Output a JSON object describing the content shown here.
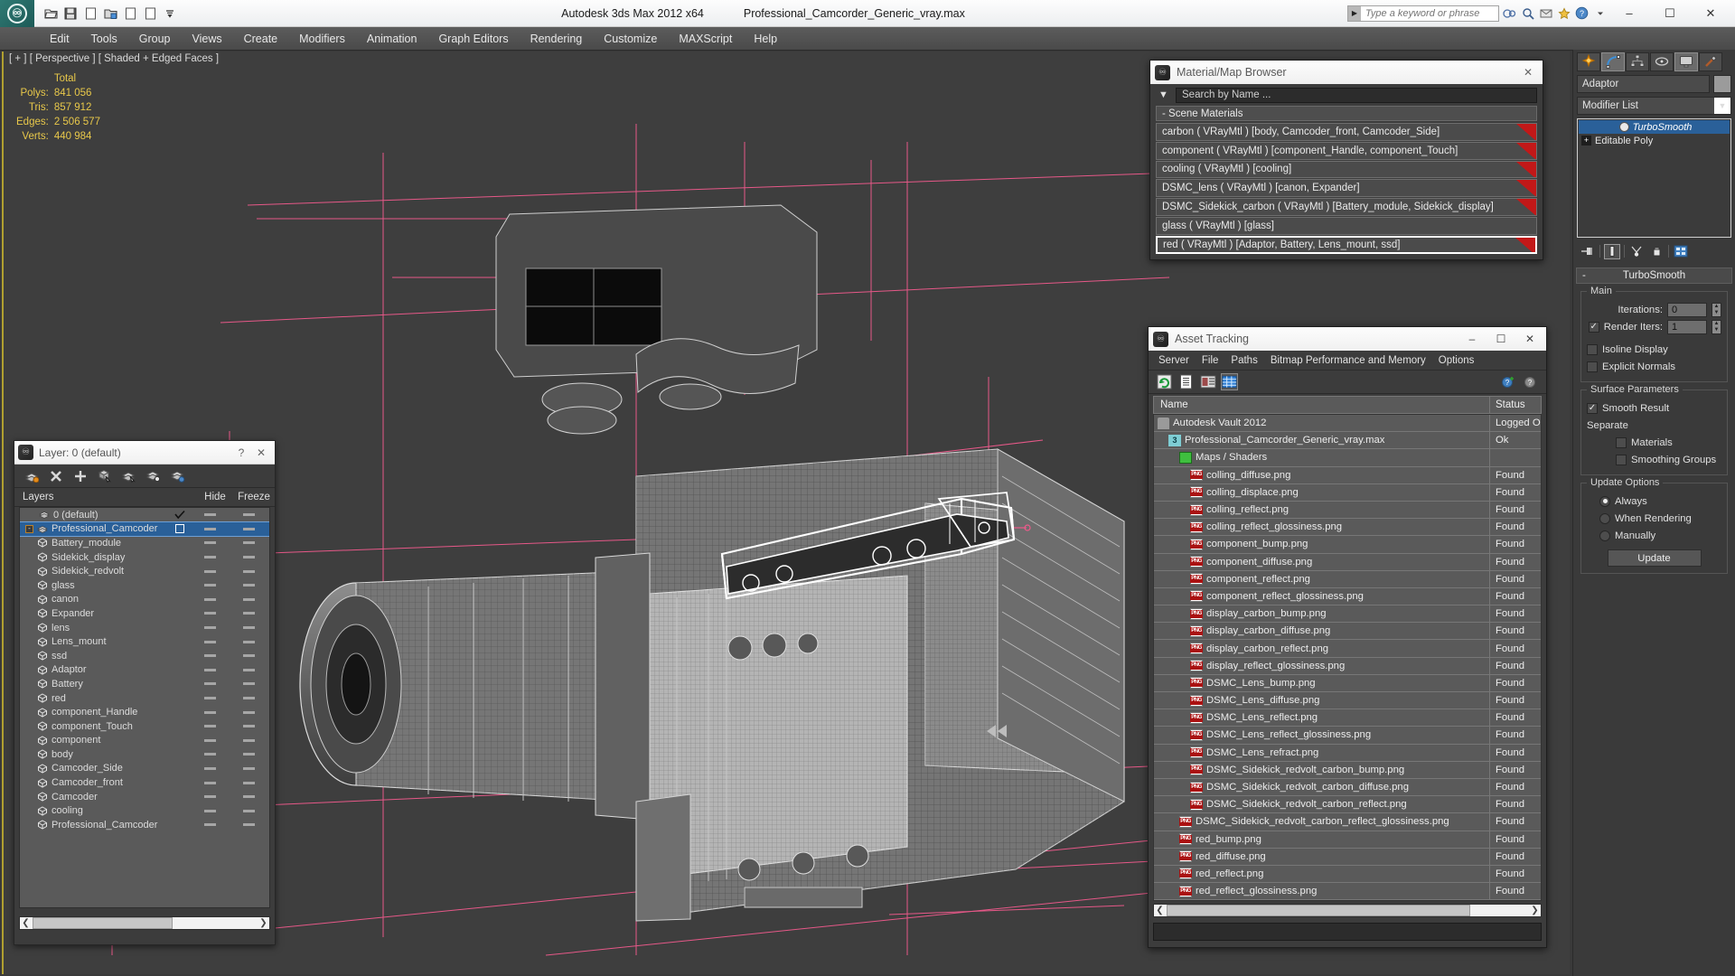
{
  "titlebar": {
    "app_title": "Autodesk 3ds Max  2012 x64",
    "file_title": "Professional_Camcorder_Generic_vray.max",
    "search_placeholder": "Type a keyword or phrase",
    "minimize": "–",
    "maximize": "☐",
    "close": "✕"
  },
  "menubar": {
    "items": [
      {
        "label": "Edit"
      },
      {
        "label": "Tools"
      },
      {
        "label": "Group"
      },
      {
        "label": "Views"
      },
      {
        "label": "Create"
      },
      {
        "label": "Modifiers"
      },
      {
        "label": "Animation"
      },
      {
        "label": "Graph Editors"
      },
      {
        "label": "Rendering"
      },
      {
        "label": "Customize"
      },
      {
        "label": "MAXScript"
      },
      {
        "label": "Help"
      }
    ]
  },
  "viewport": {
    "label": "[ + ] [ Perspective ] [ Shaded + Edged Faces ]",
    "stats_header": "Total",
    "stats": [
      {
        "label": "Polys:",
        "value": "841 056"
      },
      {
        "label": "Tris:",
        "value": "857 912"
      },
      {
        "label": "Edges:",
        "value": "2 506 577"
      },
      {
        "label": "Verts:",
        "value": "440 984"
      }
    ],
    "grid_color": "#ef5a8c",
    "bg_color": "#3e3e3e"
  },
  "layer_panel": {
    "title": "Layer: 0 (default)",
    "help_label": "?",
    "close_label": "✕",
    "columns": {
      "name": "Layers",
      "hide": "Hide",
      "freeze": "Freeze"
    },
    "toolbar_icons": [
      "create-new-layer-icon",
      "delete-layer-icon",
      "add-selection-icon",
      "select-objects-icon",
      "select-highlighted-icon",
      "highlight-selected-icon",
      "layer-properties-icon"
    ],
    "rows": [
      {
        "name": "0 (default)",
        "type": "layer",
        "indent": 1,
        "current": true,
        "selected": false
      },
      {
        "name": "Professional_Camcoder",
        "type": "layer",
        "indent": 1,
        "current": false,
        "selected": true,
        "expander": "-"
      },
      {
        "name": "Battery_module",
        "type": "object",
        "indent": 2
      },
      {
        "name": "Sidekick_display",
        "type": "object",
        "indent": 2
      },
      {
        "name": "Sidekick_redvolt",
        "type": "object",
        "indent": 2
      },
      {
        "name": "glass",
        "type": "object",
        "indent": 2
      },
      {
        "name": "canon",
        "type": "object",
        "indent": 2
      },
      {
        "name": "Expander",
        "type": "object",
        "indent": 2
      },
      {
        "name": "lens",
        "type": "object",
        "indent": 2
      },
      {
        "name": "Lens_mount",
        "type": "object",
        "indent": 2
      },
      {
        "name": "ssd",
        "type": "object",
        "indent": 2
      },
      {
        "name": "Adaptor",
        "type": "object",
        "indent": 2
      },
      {
        "name": "Battery",
        "type": "object",
        "indent": 2
      },
      {
        "name": "red",
        "type": "object",
        "indent": 2
      },
      {
        "name": "component_Handle",
        "type": "object",
        "indent": 2
      },
      {
        "name": "component_Touch",
        "type": "object",
        "indent": 2
      },
      {
        "name": "component",
        "type": "object",
        "indent": 2
      },
      {
        "name": "body",
        "type": "object",
        "indent": 2
      },
      {
        "name": "Camcoder_Side",
        "type": "object",
        "indent": 2
      },
      {
        "name": "Camcoder_front",
        "type": "object",
        "indent": 2
      },
      {
        "name": "Camcoder",
        "type": "object",
        "indent": 2
      },
      {
        "name": "cooling",
        "type": "object",
        "indent": 2
      },
      {
        "name": "Professional_Camcoder",
        "type": "object",
        "indent": 2
      }
    ]
  },
  "material_browser": {
    "title": "Material/Map Browser",
    "close_label": "✕",
    "search_placeholder": "Search by Name ...",
    "group_label": "- Scene Materials",
    "materials": [
      {
        "label": "carbon  ( VRayMtl )  [body, Camcoder_front, Camcoder_Side]",
        "swatch": "#c21818",
        "selected": false
      },
      {
        "label": "component  ( VRayMtl )  [component_Handle, component_Touch]",
        "swatch": "#c21818",
        "selected": false
      },
      {
        "label": "cooling  ( VRayMtl )  [cooling]",
        "swatch": "#c21818",
        "selected": false
      },
      {
        "label": "DSMC_lens  ( VRayMtl )  [canon, Expander]",
        "swatch": "#c21818",
        "selected": false
      },
      {
        "label": "DSMC_Sidekick_carbon  ( VRayMtl )  [Battery_module, Sidekick_display]",
        "swatch": "#c21818",
        "selected": false
      },
      {
        "label": "glass  ( VRayMtl )  [glass]",
        "swatch": null,
        "selected": false
      },
      {
        "label": "red  ( VRayMtl )  [Adaptor, Battery, Lens_mount, ssd]",
        "swatch": "#c21818",
        "selected": true
      }
    ]
  },
  "asset_tracking": {
    "title": "Asset Tracking",
    "minimize": "–",
    "maximize": "☐",
    "close": "✕",
    "menu": [
      {
        "label": "Server"
      },
      {
        "label": "File"
      },
      {
        "label": "Paths"
      },
      {
        "label": "Bitmap Performance and Memory"
      },
      {
        "label": "Options"
      }
    ],
    "toolbar_icons": [
      "refresh-icon",
      "list-view-icon",
      "detail-view-icon",
      "grid-view-icon"
    ],
    "help_icons": [
      "help-add-icon",
      "help-icon"
    ],
    "columns": {
      "name": "Name",
      "status": "Status"
    },
    "rows": [
      {
        "name": "Autodesk Vault 2012",
        "status": "Logged O",
        "indent": 1,
        "icon": "vault"
      },
      {
        "name": "Professional_Camcorder_Generic_vray.max",
        "status": "Ok",
        "indent": 2,
        "icon": "max"
      },
      {
        "name": "Maps / Shaders",
        "status": "",
        "indent": 3,
        "icon": "map"
      },
      {
        "name": "colling_diffuse.png",
        "status": "Found",
        "indent": 4,
        "icon": "png"
      },
      {
        "name": "colling_displace.png",
        "status": "Found",
        "indent": 4,
        "icon": "png"
      },
      {
        "name": "colling_reflect.png",
        "status": "Found",
        "indent": 4,
        "icon": "png"
      },
      {
        "name": "colling_reflect_glossiness.png",
        "status": "Found",
        "indent": 4,
        "icon": "png"
      },
      {
        "name": "component_bump.png",
        "status": "Found",
        "indent": 4,
        "icon": "png"
      },
      {
        "name": "component_diffuse.png",
        "status": "Found",
        "indent": 4,
        "icon": "png"
      },
      {
        "name": "component_reflect.png",
        "status": "Found",
        "indent": 4,
        "icon": "png"
      },
      {
        "name": "component_reflect_glossiness.png",
        "status": "Found",
        "indent": 4,
        "icon": "png"
      },
      {
        "name": "display_carbon_bump.png",
        "status": "Found",
        "indent": 4,
        "icon": "png"
      },
      {
        "name": "display_carbon_diffuse.png",
        "status": "Found",
        "indent": 4,
        "icon": "png"
      },
      {
        "name": "display_carbon_reflect.png",
        "status": "Found",
        "indent": 4,
        "icon": "png"
      },
      {
        "name": "display_reflect_glossiness.png",
        "status": "Found",
        "indent": 4,
        "icon": "png"
      },
      {
        "name": "DSMC_Lens_bump.png",
        "status": "Found",
        "indent": 4,
        "icon": "png"
      },
      {
        "name": "DSMC_Lens_diffuse.png",
        "status": "Found",
        "indent": 4,
        "icon": "png"
      },
      {
        "name": "DSMC_Lens_reflect.png",
        "status": "Found",
        "indent": 4,
        "icon": "png"
      },
      {
        "name": "DSMC_Lens_reflect_glossiness.png",
        "status": "Found",
        "indent": 4,
        "icon": "png"
      },
      {
        "name": "DSMC_Lens_refract.png",
        "status": "Found",
        "indent": 4,
        "icon": "png"
      },
      {
        "name": "DSMC_Sidekick_redvolt_carbon_bump.png",
        "status": "Found",
        "indent": 4,
        "icon": "png"
      },
      {
        "name": "DSMC_Sidekick_redvolt_carbon_diffuse.png",
        "status": "Found",
        "indent": 4,
        "icon": "png"
      },
      {
        "name": "DSMC_Sidekick_redvolt_carbon_reflect.png",
        "status": "Found",
        "indent": 4,
        "icon": "png"
      },
      {
        "name": "DSMC_Sidekick_redvolt_carbon_reflect_glossiness.png",
        "status": "Found",
        "indent": 3,
        "icon": "png"
      },
      {
        "name": "red_bump.png",
        "status": "Found",
        "indent": 3,
        "icon": "png"
      },
      {
        "name": "red_diffuse.png",
        "status": "Found",
        "indent": 3,
        "icon": "png"
      },
      {
        "name": "red_reflect.png",
        "status": "Found",
        "indent": 3,
        "icon": "png"
      },
      {
        "name": "red_reflect_glossiness.png",
        "status": "Found",
        "indent": 3,
        "icon": "png"
      }
    ]
  },
  "command_panel": {
    "tabs": [
      {
        "name": "create-tab",
        "on": false
      },
      {
        "name": "modify-tab",
        "on": true
      },
      {
        "name": "hierarchy-tab",
        "on": false
      },
      {
        "name": "motion-tab",
        "on": false
      },
      {
        "name": "display-tab",
        "on": true
      },
      {
        "name": "utilities-tab",
        "on": false
      }
    ],
    "object_name": "Adaptor",
    "object_color": "#9b9b9b",
    "modifier_list_label": "Modifier List",
    "stack": [
      {
        "label": "TurboSmooth",
        "selected": true
      },
      {
        "label": "Editable Poly",
        "selected": false,
        "expand": "+"
      }
    ],
    "stack_tools": [
      "pin-stack-icon",
      "show-end-result-icon",
      "make-unique-icon",
      "remove-modifier-icon",
      "configure-sets-icon"
    ],
    "rollup": {
      "title": "TurboSmooth",
      "collapse": "-",
      "main": {
        "caption": "Main",
        "iterations_label": "Iterations:",
        "iterations_value": "0",
        "render_iters_label": "Render Iters:",
        "render_iters_value": "1",
        "render_iters_checked": true,
        "isoline_label": "Isoline Display",
        "isoline_checked": false,
        "explicit_label": "Explicit Normals",
        "explicit_checked": false
      },
      "surface": {
        "caption": "Surface Parameters",
        "smooth_result_label": "Smooth Result",
        "smooth_result_checked": true,
        "separate_label": "Separate",
        "materials_label": "Materials",
        "materials_checked": false,
        "smoothing_groups_label": "Smoothing Groups",
        "smoothing_groups_checked": false
      },
      "update": {
        "caption": "Update Options",
        "options": [
          {
            "label": "Always",
            "selected": true
          },
          {
            "label": "When Rendering",
            "selected": false
          },
          {
            "label": "Manually",
            "selected": false
          }
        ],
        "button_label": "Update"
      }
    }
  }
}
